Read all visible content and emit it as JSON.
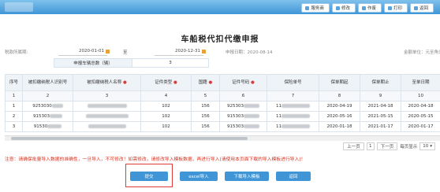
{
  "toolbar": {
    "buttons": [
      {
        "label": "服务商"
      },
      {
        "label": "修改"
      },
      {
        "label": "作废"
      },
      {
        "label": "打印"
      },
      {
        "label": "返回"
      }
    ]
  },
  "page": {
    "title": "车船税代扣代缴申报"
  },
  "period": {
    "label": "税款所属期:",
    "start": "2020-01-01",
    "sep": "至",
    "end": "2020-12-31",
    "report_date": "申报日期：2020-08-14",
    "unit": "金额单位：元至角分"
  },
  "count": {
    "label": "申报车辆总数（辆）",
    "value": "3"
  },
  "table": {
    "headers": [
      "序号",
      "被扣缴纳税人识别号",
      "被扣缴纳税人名称",
      "证件类型",
      "国籍",
      "证件号码",
      "保险单号",
      "保单期起",
      "保单期止",
      "至单日期"
    ],
    "required": [
      false,
      false,
      true,
      true,
      true,
      true,
      false,
      false,
      false,
      false
    ],
    "col_numbers": [
      "1",
      "2",
      "3",
      "4",
      "5",
      "6",
      "7",
      "8",
      "9",
      "10"
    ],
    "rows": [
      {
        "no": "1",
        "taxid": "9253030",
        "name": "",
        "cert": "102",
        "nation": "156",
        "certno": "925303",
        "policy": "11",
        "start": "2020-04-19",
        "end": "2021-04-18",
        "date": "2020-04-18"
      },
      {
        "no": "2",
        "taxid": "915303",
        "name": "",
        "cert": "102",
        "nation": "156",
        "certno": "915303",
        "policy": "11",
        "start": "2020-05-16",
        "end": "2021-05-15",
        "date": "2020-05-15"
      },
      {
        "no": "3",
        "taxid": "91530",
        "name": "",
        "cert": "102",
        "nation": "156",
        "certno": "915303",
        "policy": "11",
        "start": "2020-01-18",
        "end": "2021-01-17",
        "date": "2020-01-17"
      }
    ]
  },
  "pager": {
    "prev": "上一页",
    "current": "1",
    "next": "下一页",
    "size_label": "每页显示",
    "size": "10"
  },
  "notice": "注意：请确保批量导入数据的准确性，一旦导入，不可修改！如需修改，请修改导入模板数据，再进行导入(请使用本页面下载的导入模板进行导入)！",
  "actions": {
    "submit": "提交",
    "excel_import": "excel导入",
    "download_template": "下载导入模板",
    "back": "返回"
  },
  "colors": {
    "accent": "#3f95d6",
    "warning": "#d9321f",
    "highlight": "#e13b3b"
  }
}
